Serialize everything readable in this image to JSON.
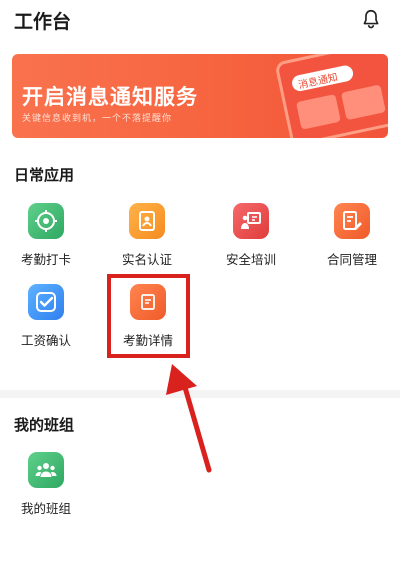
{
  "header": {
    "title": "工作台",
    "bell_icon": "bell-icon"
  },
  "banner": {
    "title": "开启消息通知服务",
    "subtitle": "关键信息收到机，一个不落提醒你",
    "phone_label": "消息通知",
    "colors": {
      "start": "#f9724e",
      "end": "#f1533a"
    }
  },
  "daily_apps": {
    "title": "日常应用",
    "items": [
      {
        "label": "考勤打卡",
        "icon": "location-target-icon",
        "color": "#2ea862"
      },
      {
        "label": "实名认证",
        "icon": "id-badge-icon",
        "color": "#f58b1f"
      },
      {
        "label": "安全培训",
        "icon": "presenter-board-icon",
        "color": "#e03b3b"
      },
      {
        "label": "合同管理",
        "icon": "contract-pen-icon",
        "color": "#f05a2a"
      },
      {
        "label": "工资确认",
        "icon": "check-shield-icon",
        "color": "#2f7fef"
      },
      {
        "label": "考勤详情",
        "icon": "document-list-icon",
        "color": "#f05a2a"
      }
    ]
  },
  "my_team": {
    "title": "我的班组",
    "items": [
      {
        "label": "我的班组",
        "icon": "group-people-icon",
        "color": "#2ea862"
      }
    ]
  },
  "annotation": {
    "highlight_color": "#d9211d"
  }
}
